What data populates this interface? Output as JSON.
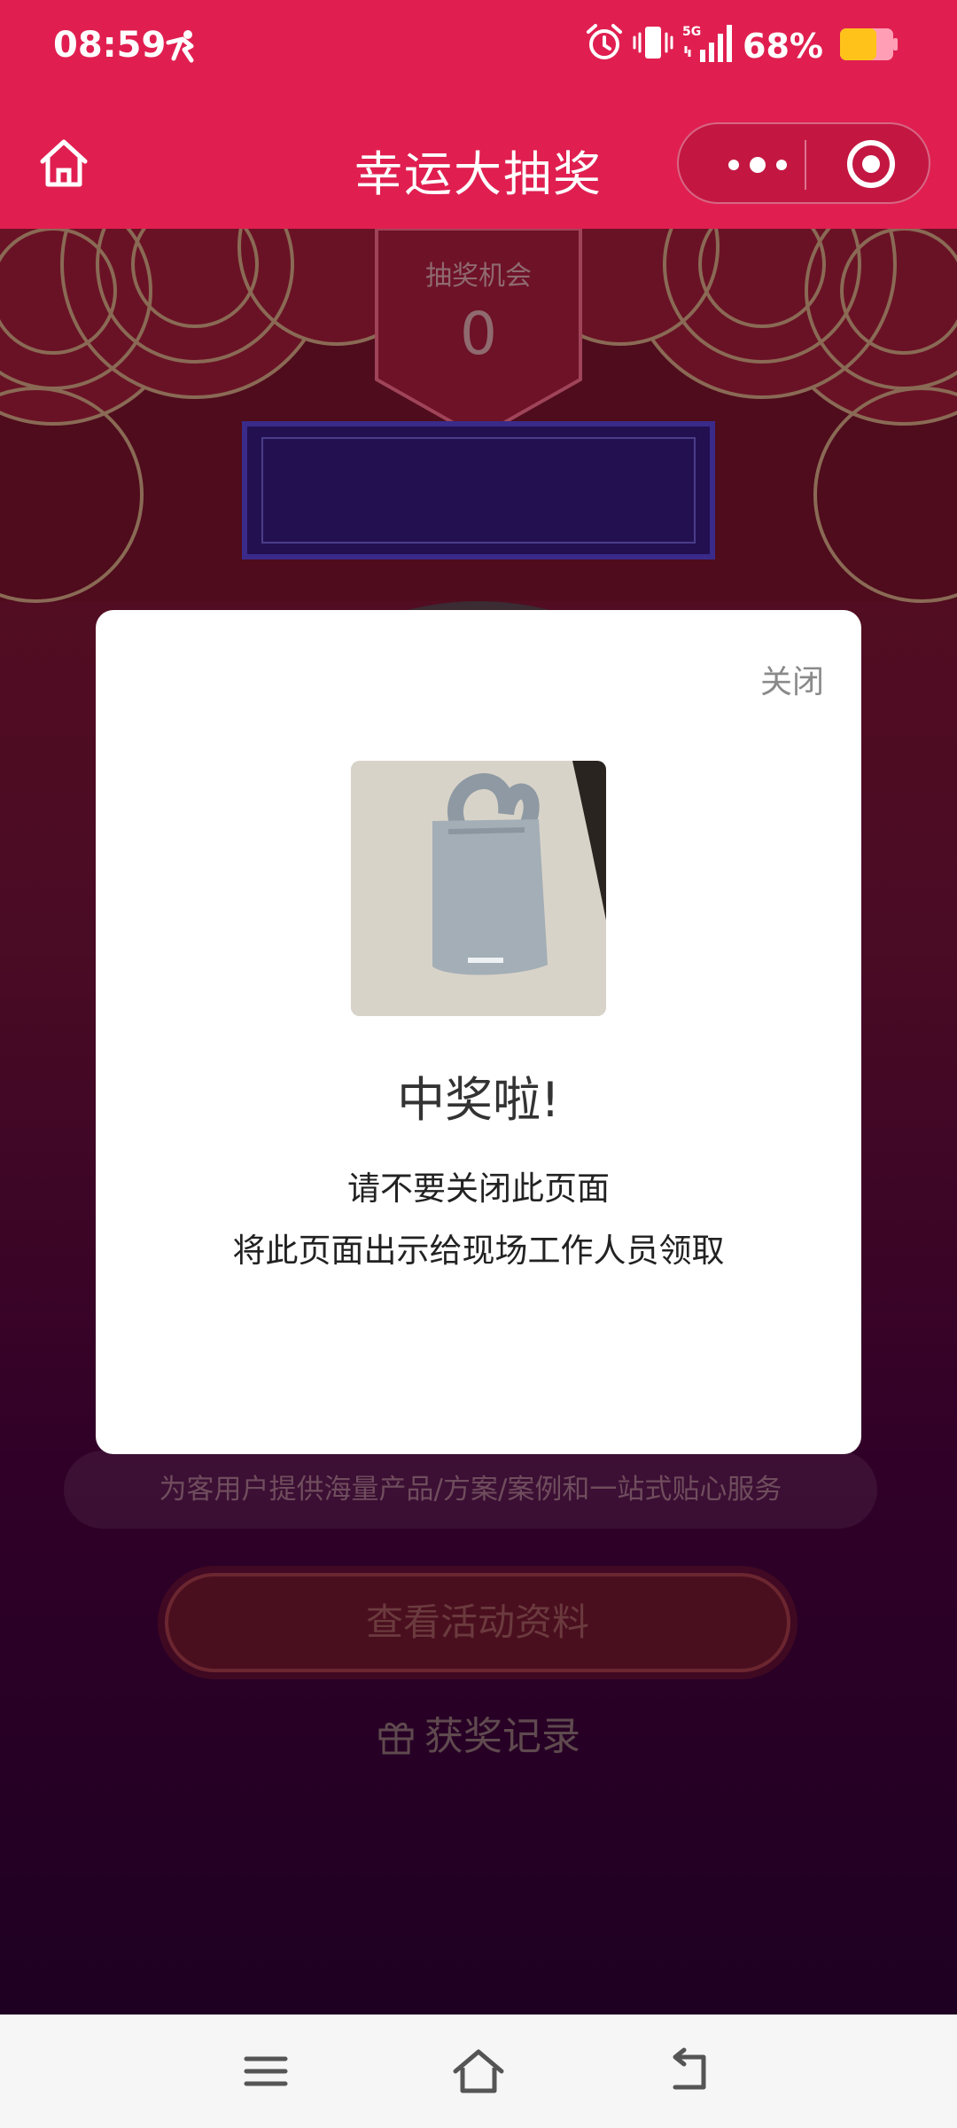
{
  "status_bar": {
    "time": "08:59",
    "network": "5G",
    "battery_percent": "68%",
    "battery_level": 0.68,
    "icons": [
      "person-icon",
      "alarm-icon",
      "vibrate-icon",
      "signal-icon",
      "battery-icon"
    ]
  },
  "nav_bar": {
    "title": "幸运大抽奖",
    "icons": [
      "home-icon",
      "more-icon",
      "target-icon"
    ]
  },
  "stage": {
    "chance_label": "抽奖机会",
    "chance_value": "0"
  },
  "page": {
    "slogan": "为客用户提供海量产品/方案/案例和一站式贴心服务",
    "view_button_label": "查看活动资料",
    "record_link_label": "获奖记录",
    "record_icon": "gift-icon"
  },
  "modal": {
    "close_label": "关闭",
    "prize_image": "tote-bag-image",
    "title": "中奖啦!",
    "line1": "请不要关闭此页面",
    "line2": "将此页面出示给现场工作人员领取"
  },
  "colors": {
    "header": "#e01f50",
    "modal_bg": "#ffffff",
    "page_top": "#5a0f1f",
    "page_bottom": "#1e0022"
  },
  "system_nav": {
    "icons": [
      "menu-icon",
      "home-icon",
      "back-icon"
    ]
  }
}
